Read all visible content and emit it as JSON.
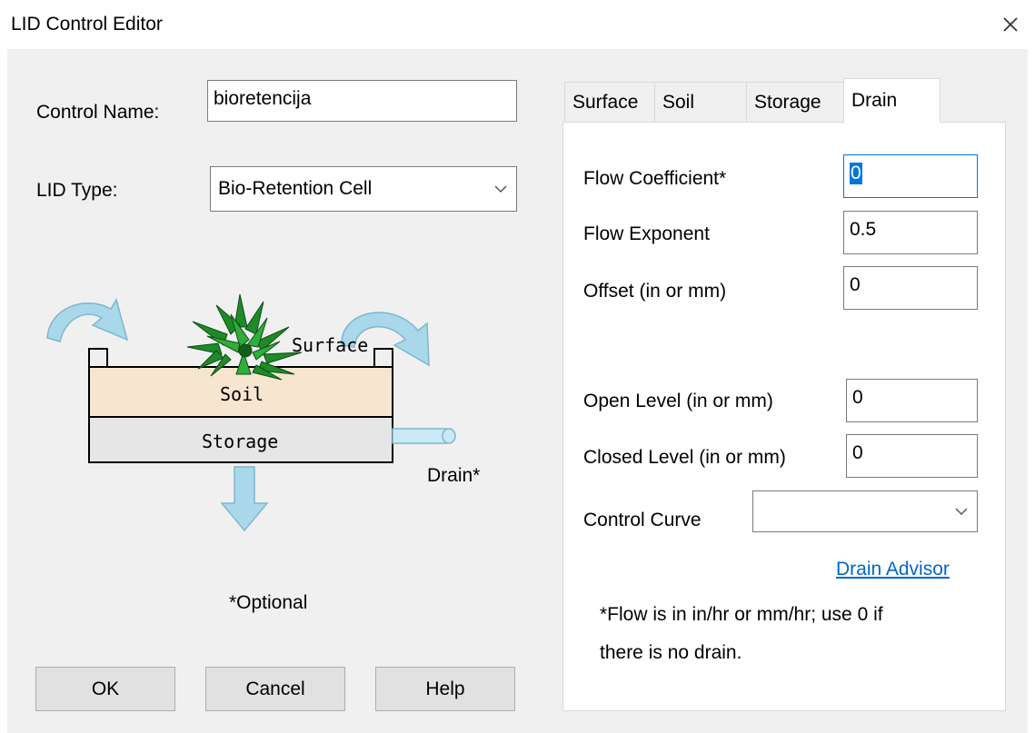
{
  "window": {
    "title": "LID Control Editor"
  },
  "control_name": {
    "label": "Control Name:",
    "value": "bioretencija"
  },
  "lid_type": {
    "label": "LID Type:",
    "value": "Bio-Retention Cell"
  },
  "diagram": {
    "surface_label": "Surface",
    "soil_label": "Soil",
    "storage_label": "Storage",
    "drain_label": "Drain*",
    "optional_note": "*Optional"
  },
  "buttons": {
    "ok": "OK",
    "cancel": "Cancel",
    "help": "Help"
  },
  "tabs": [
    {
      "label": "Surface"
    },
    {
      "label": "Soil"
    },
    {
      "label": "Storage"
    },
    {
      "label": "Drain",
      "active": true
    }
  ],
  "drain": {
    "flow_coefficient": {
      "label": "Flow Coefficient*",
      "value": "0"
    },
    "flow_exponent": {
      "label": "Flow Exponent",
      "value": "0.5"
    },
    "offset": {
      "label": "Offset (in or mm)",
      "value": "0"
    },
    "open_level": {
      "label": "Open Level (in or mm)",
      "value": "0"
    },
    "closed_level": {
      "label": "Closed Level (in or mm)",
      "value": "0"
    },
    "control_curve": {
      "label": "Control Curve",
      "value": ""
    },
    "advisor_link": "Drain Advisor",
    "note_line1": "*Flow is in in/hr or mm/hr; use 0 if",
    "note_line2": "there is no drain."
  },
  "colors": {
    "dialog_bg": "#f0f0f0",
    "soil": "#f7e6cf",
    "storage": "#e6e6e6",
    "arrow": "#a9d8ea",
    "link": "#0066cc",
    "selection": "#0078d7"
  }
}
